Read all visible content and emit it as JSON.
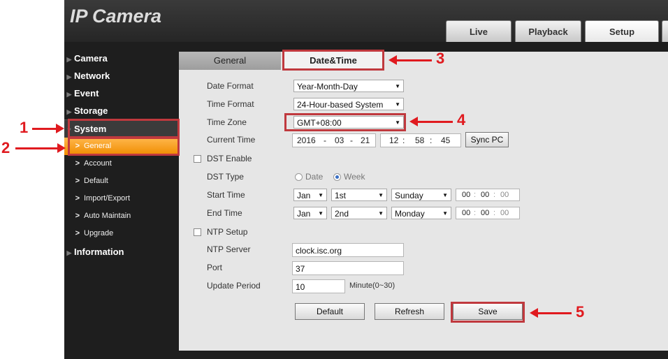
{
  "app": {
    "logo": "IP Camera",
    "top_tabs": [
      "Live",
      "Playback",
      "Setup"
    ]
  },
  "sidebar": {
    "items": [
      {
        "label": "Camera"
      },
      {
        "label": "Network"
      },
      {
        "label": "Event"
      },
      {
        "label": "Storage"
      },
      {
        "label": "System",
        "expanded": true
      },
      {
        "label": "Information"
      }
    ],
    "system_sub": [
      "General",
      "Account",
      "Default",
      "Import/Export",
      "Auto Maintain",
      "Upgrade"
    ],
    "active_sub": "General"
  },
  "content_tabs": [
    "General",
    "Date&Time"
  ],
  "active_tab": "Date&Time",
  "form": {
    "date_format": {
      "label": "Date Format",
      "value": "Year-Month-Day"
    },
    "time_format": {
      "label": "Time Format",
      "value": "24-Hour-based System"
    },
    "time_zone": {
      "label": "Time Zone",
      "value": "GMT+08:00"
    },
    "current_time": {
      "label": "Current Time",
      "year": "2016",
      "month": "03",
      "day": "21",
      "hour": "12",
      "minute": "58",
      "second": "45",
      "sep_date": "-",
      "sep_time": ":",
      "sync_label": "Sync PC"
    },
    "dst_enable": {
      "label": "DST Enable",
      "checked": false
    },
    "dst_type": {
      "label": "DST Type",
      "options": [
        "Date",
        "Week"
      ],
      "selected": "Week"
    },
    "start_time": {
      "label": "Start Time",
      "month": "Jan",
      "week": "1st",
      "day": "Sunday",
      "h": "00",
      "m": "00",
      "s": "00"
    },
    "end_time": {
      "label": "End Time",
      "month": "Jan",
      "week": "2nd",
      "day": "Monday",
      "h": "00",
      "m": "00",
      "s": "00"
    },
    "ntp_setup": {
      "label": "NTP Setup",
      "checked": false
    },
    "ntp_server": {
      "label": "NTP Server",
      "value": "clock.isc.org"
    },
    "port": {
      "label": "Port",
      "value": "37"
    },
    "update_period": {
      "label": "Update Period",
      "value": "10",
      "unit": "Minute(0~30)"
    }
  },
  "buttons": {
    "default": "Default",
    "refresh": "Refresh",
    "save": "Save"
  },
  "annotations": [
    "1",
    "2",
    "3",
    "4",
    "5"
  ],
  "colors": {
    "annotation": "#e01a1f",
    "highlight": "#c0393e",
    "active_sub": "#f08c00"
  }
}
